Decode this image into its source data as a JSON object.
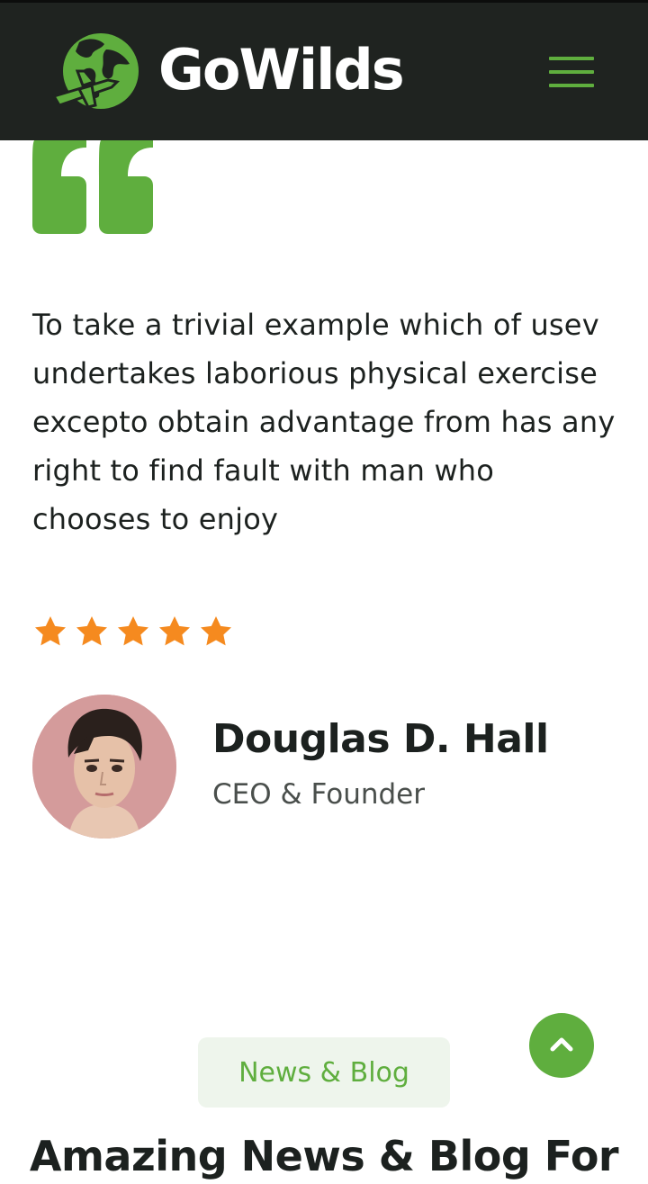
{
  "header": {
    "brand": "GoWilds",
    "menu_icon": "hamburger-menu-icon"
  },
  "testimonial": {
    "quote_icon": "quote-mark-icon",
    "text": "To take a trivial example which of usev undertakes laborious physical exercise excepto obtain advantage from has any right to find fault with man who chooses to enjoy",
    "rating": 5,
    "rating_max": 5,
    "author": {
      "name": "Douglas D. Hall",
      "role": "CEO & Founder"
    }
  },
  "blog": {
    "badge": "News & Blog",
    "title": "Amazing News & Blog For"
  },
  "scroll_top_icon": "chevron-up-icon",
  "colors": {
    "accent": "#5fae3e",
    "header_bg": "#1f2320",
    "star": "#f58a1f",
    "text": "#1c211f"
  }
}
